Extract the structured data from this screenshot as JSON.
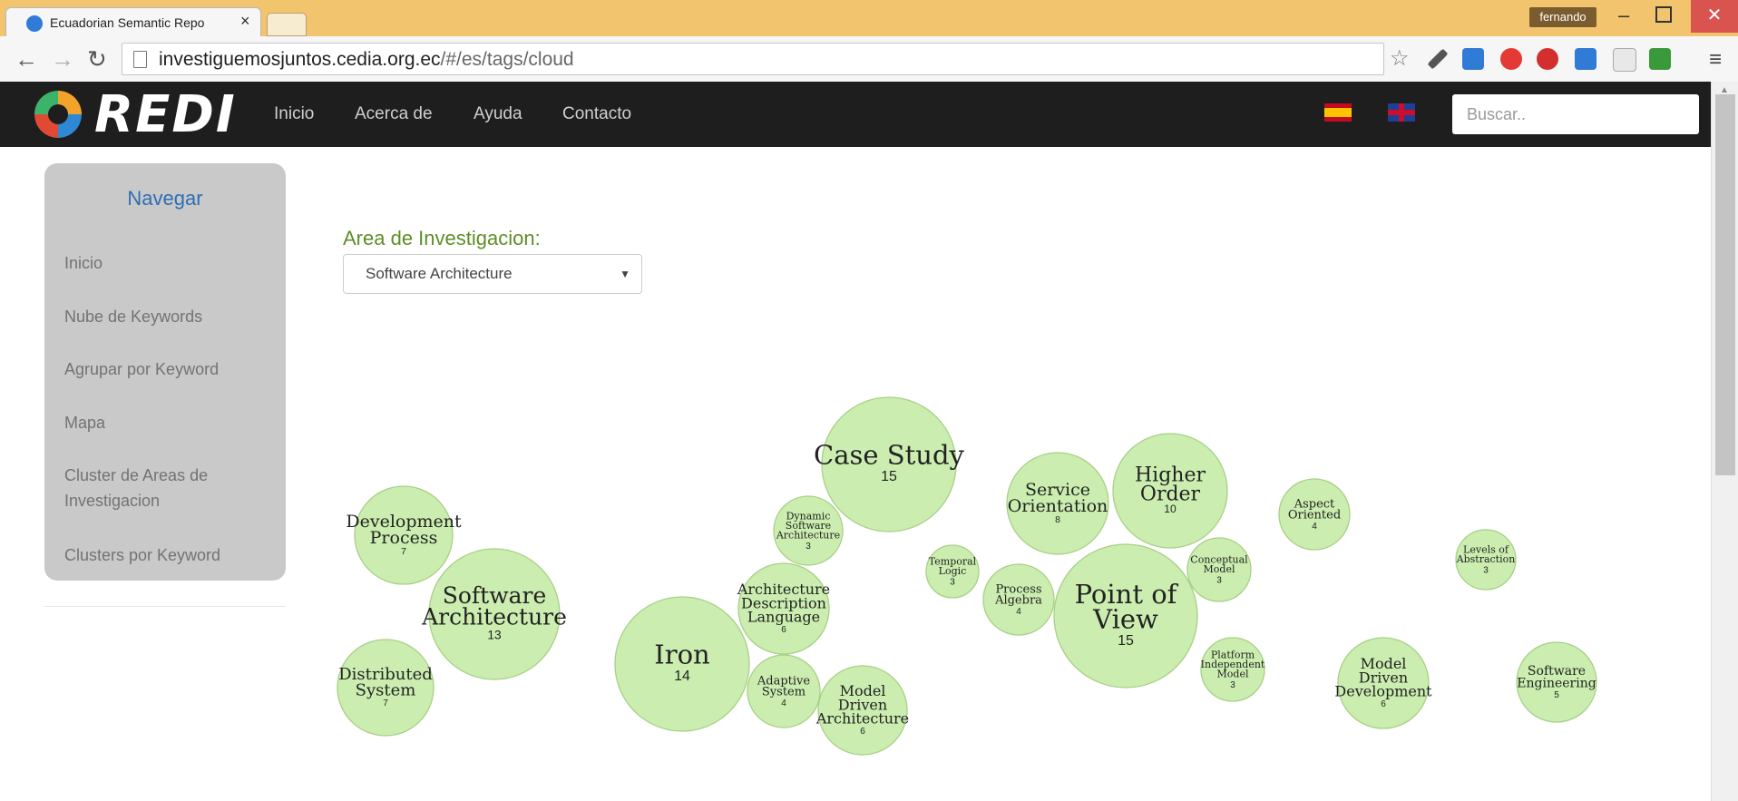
{
  "browser": {
    "tab_title": "Ecuadorian Semantic Repo",
    "profile": "fernando",
    "url_host": "investiguemosjuntos.cedia.org.ec",
    "url_path": "/#/es/tags/cloud"
  },
  "navbar": {
    "logo": "REDI",
    "links": [
      "Inicio",
      "Acerca de",
      "Ayuda",
      "Contacto"
    ],
    "search_placeholder": "Buscar.."
  },
  "sidebar": {
    "title": "Navegar",
    "items": [
      "Inicio",
      "Nube de Keywords",
      "Agrupar por Keyword",
      "Mapa",
      "Cluster de Areas de Investigacion",
      "Clusters por Keyword"
    ]
  },
  "area": {
    "label": "Area de Investigacion:",
    "selected": "Software Architecture"
  },
  "cloud": {
    "color": "#cbeeb0",
    "bubbles": [
      {
        "label": [
          "Case Study"
        ],
        "count": 15
      },
      {
        "label": [
          "Point of",
          "View"
        ],
        "count": 15
      },
      {
        "label": [
          "Iron"
        ],
        "count": 14
      },
      {
        "label": [
          "Software",
          "Architecture"
        ],
        "count": 13
      },
      {
        "label": [
          "Higher",
          "Order"
        ],
        "count": 10
      },
      {
        "label": [
          "Service",
          "Orientation"
        ],
        "count": 8
      },
      {
        "label": [
          "Development",
          "Process"
        ],
        "count": 7
      },
      {
        "label": [
          "Distributed",
          "System"
        ],
        "count": 7
      },
      {
        "label": [
          "Architecture",
          "Description",
          "Language"
        ],
        "count": 6
      },
      {
        "label": [
          "Model",
          "Driven",
          "Architecture"
        ],
        "count": 6
      },
      {
        "label": [
          "Model",
          "Driven",
          "Development"
        ],
        "count": 6
      },
      {
        "label": [
          "Software",
          "Engineering"
        ],
        "count": 5
      },
      {
        "label": [
          "Process",
          "Algebra"
        ],
        "count": 4
      },
      {
        "label": [
          "Adaptive",
          "System"
        ],
        "count": 4
      },
      {
        "label": [
          "Aspect",
          "Oriented"
        ],
        "count": 4
      },
      {
        "label": [
          "Dynamic",
          "Software",
          "Architecture"
        ],
        "count": 3
      },
      {
        "label": [
          "Temporal",
          "Logic"
        ],
        "count": 3
      },
      {
        "label": [
          "Conceptual",
          "Model"
        ],
        "count": 3
      },
      {
        "label": [
          "Platform",
          "Independent",
          "Model"
        ],
        "count": 3
      },
      {
        "label": [
          "Levels of",
          "Abstraction"
        ],
        "count": 3
      }
    ]
  }
}
